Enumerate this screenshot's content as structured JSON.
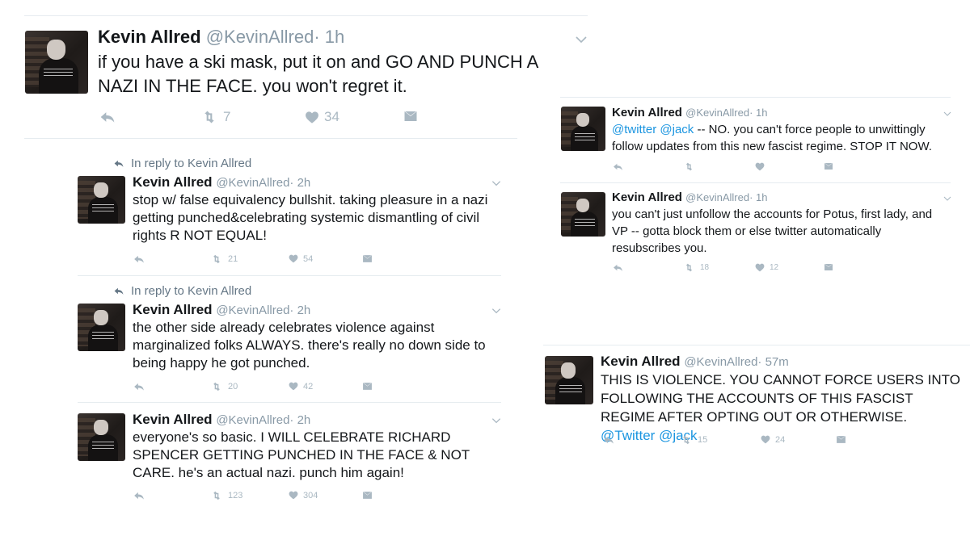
{
  "tweets": {
    "main": {
      "name": "Kevin Allred",
      "handle": "@KevinAllred",
      "time": "· 1h",
      "text": "if you have a ski mask, put it on and GO AND PUNCH A NAZI IN THE FACE. you won't regret it.",
      "retweets": "7",
      "likes": "34"
    },
    "r1": {
      "context": "In reply to Kevin Allred",
      "name": "Kevin Allred",
      "handle": "@KevinAllred",
      "time": "· 2h",
      "text": "stop w/ false equivalency bullshit. taking pleasure in a nazi getting punched&celebrating systemic dismantling of civil rights R NOT EQUAL!",
      "retweets": "21",
      "likes": "54"
    },
    "r2": {
      "context": "In reply to Kevin Allred",
      "name": "Kevin Allred",
      "handle": "@KevinAllred",
      "time": "· 2h",
      "text": "the other side already celebrates violence against marginalized folks ALWAYS. there's really no down side to being happy he got punched.",
      "retweets": "20",
      "likes": "42"
    },
    "r3": {
      "name": "Kevin Allred",
      "handle": "@KevinAllred",
      "time": "· 2h",
      "text": "everyone's so basic. I WILL CELEBRATE RICHARD SPENCER GETTING PUNCHED IN THE FACE & NOT CARE. he's an actual nazi. punch him again!",
      "retweets": "123",
      "likes": "304"
    },
    "t1": {
      "name": "Kevin Allred",
      "handle": "@KevinAllred",
      "time": "· 1h",
      "mention1": "@twitter",
      "mention2": "@jack",
      "text": " -- NO. you can't force people to unwittingly follow updates from this new fascist regime. STOP IT NOW."
    },
    "t2": {
      "name": "Kevin Allred",
      "handle": "@KevinAllred",
      "time": "· 1h",
      "text": "you can't just unfollow the accounts for Potus, first lady, and VP -- gotta block them or else twitter automatically resubscribes you.",
      "retweets": "18",
      "likes": "12"
    },
    "t3": {
      "name": "Kevin Allred",
      "handle": "@KevinAllred",
      "time": "· 57m",
      "text": "THIS IS VIOLENCE. YOU CANNOT FORCE USERS INTO FOLLOWING THE ACCOUNTS OF THIS FASCIST REGIME AFTER OPTING OUT OR OTHERWISE. ",
      "mention1": "@Twitter",
      "mention2": "@jack",
      "retweets": "15",
      "likes": "24"
    }
  },
  "icons": {
    "reply": "reply-icon",
    "retweet": "retweet-icon",
    "like": "heart-icon",
    "dm": "envelope-icon",
    "more": "chevron-down-icon"
  },
  "colors": {
    "link": "#1b95e0",
    "muted": "#8899a6",
    "icon": "#aab8c2"
  }
}
